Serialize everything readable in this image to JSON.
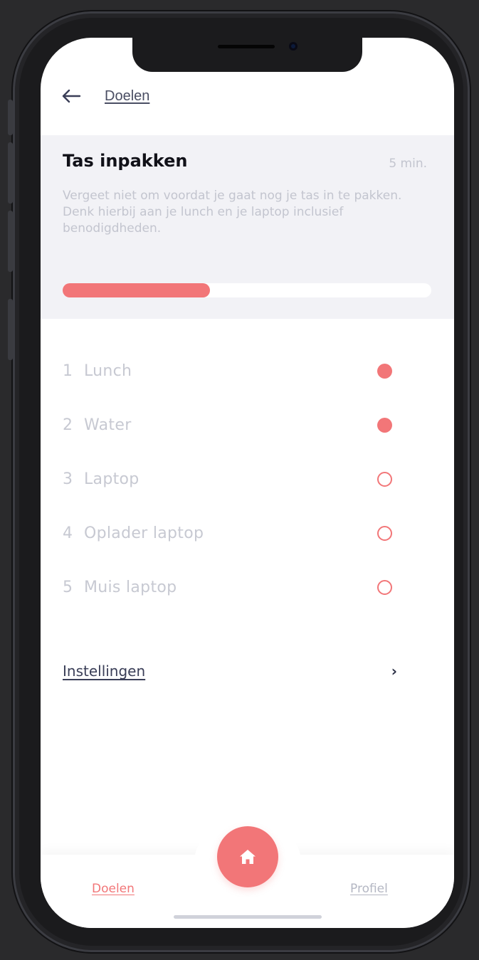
{
  "header": {
    "back_icon": "arrow-left-icon",
    "title": "Doelen"
  },
  "task": {
    "title": "Tas inpakken",
    "duration": "5 min.",
    "description": "Vergeet niet om voordat je gaat nog je tas in te pakken. Denk hierbij aan je lunch en je laptop inclusief benodigdheden.",
    "progress_fraction": 0.4
  },
  "checklist": [
    {
      "number": "1",
      "label": "Lunch",
      "checked": true
    },
    {
      "number": "2",
      "label": "Water",
      "checked": true
    },
    {
      "number": "3",
      "label": "Laptop",
      "checked": false
    },
    {
      "number": "4",
      "label": "Oplader laptop",
      "checked": false
    },
    {
      "number": "5",
      "label": "Muis laptop",
      "checked": false
    }
  ],
  "settings": {
    "label": "Instellingen",
    "chevron": "›"
  },
  "bottom_nav": {
    "left_tab": "Doelen",
    "right_tab": "Profiel",
    "center_icon": "home-icon"
  },
  "colors": {
    "accent": "#f27678",
    "card_background": "#f2f2f6",
    "muted_text": "#c7c9d2"
  }
}
